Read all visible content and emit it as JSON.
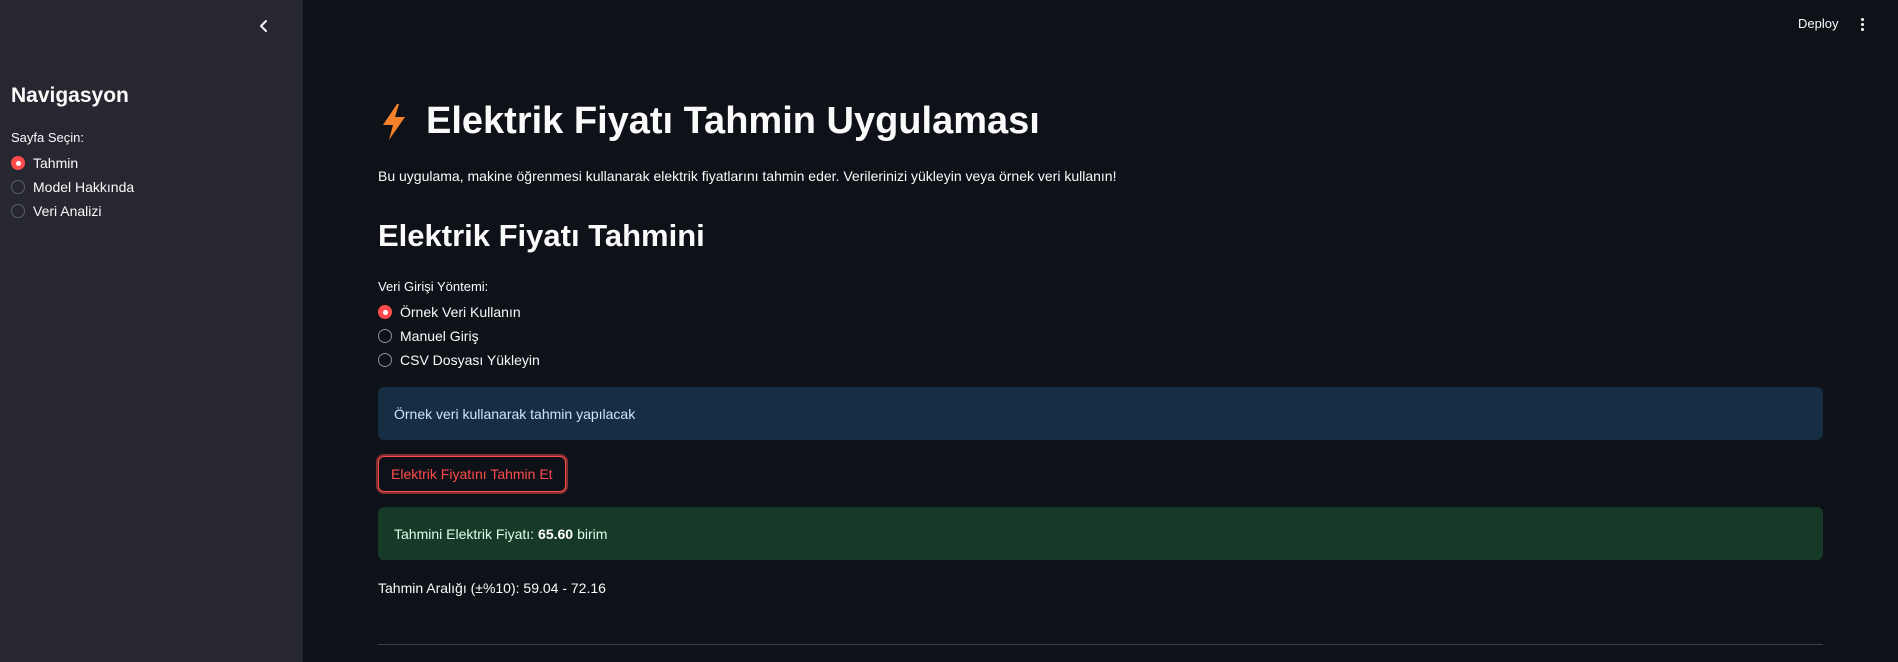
{
  "sidebar": {
    "title": "Navigasyon",
    "select_label": "Sayfa Seçin:",
    "items": [
      {
        "label": "Tahmin",
        "selected": true
      },
      {
        "label": "Model Hakkında",
        "selected": false
      },
      {
        "label": "Veri Analizi",
        "selected": false
      }
    ]
  },
  "topbar": {
    "deploy_label": "Deploy"
  },
  "main": {
    "title": "Elektrik Fiyatı Tahmin Uygulaması",
    "description": "Bu uygulama, makine öğrenmesi kullanarak elektrik fiyatlarını tahmin eder. Verilerinizi yükleyin veya örnek veri kullanın!",
    "section_title": "Elektrik Fiyatı Tahmini",
    "input_method_label": "Veri Girişi Yöntemi:",
    "input_methods": [
      {
        "label": "Örnek Veri Kullanın",
        "selected": true
      },
      {
        "label": "Manuel Giriş",
        "selected": false
      },
      {
        "label": "CSV Dosyası Yükleyin",
        "selected": false
      }
    ],
    "info_message": "Örnek veri kullanarak tahmin yapılacak",
    "predict_button": "Elektrik Fiyatını Tahmin Et",
    "result_prefix": "Tahmini Elektrik Fiyatı:",
    "result_value": "65.60",
    "result_unit": "birim",
    "range_text": "Tahmin Aralığı (±%10): 59.04 - 72.16"
  },
  "colors": {
    "accent": "#ff4b4b",
    "icon_orange": "#f5822a",
    "background": "#0e1117",
    "sidebar": "#262730",
    "info_bg": "#172d43",
    "success_bg": "#173928"
  }
}
